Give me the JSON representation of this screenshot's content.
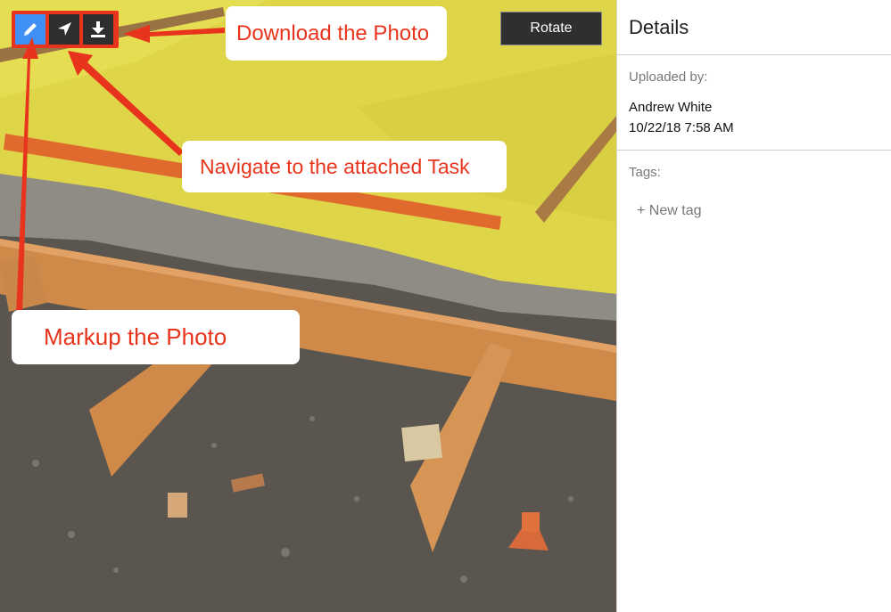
{
  "photo": {
    "toolbar": {
      "markup_icon": "pencil-icon",
      "navigate_icon": "location-arrow-icon",
      "download_icon": "download-icon"
    },
    "rotate_label": "Rotate",
    "callouts": {
      "download": "Download the Photo",
      "navigate": "Navigate to the attached Task",
      "markup": "Markup the Photo"
    },
    "colors": {
      "annotation_red": "#e8341c",
      "markup_active_blue": "#3f8ff4"
    }
  },
  "details": {
    "title": "Details",
    "uploaded_by_label": "Uploaded by:",
    "uploader_name": "Andrew White",
    "uploaded_at": "10/22/18 7:58 AM",
    "tags_label": "Tags:",
    "new_tag_label": "+ New tag"
  }
}
